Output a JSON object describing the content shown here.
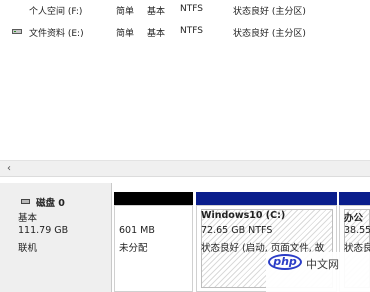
{
  "volumes": [
    {
      "name": "个人空间 (F:)",
      "layout": "简单",
      "type": "基本",
      "fs": "NTFS",
      "status": "状态良好 (主分区)"
    },
    {
      "name": "文件资料 (E:)",
      "layout": "简单",
      "type": "基本",
      "fs": "NTFS",
      "status": "状态良好 (主分区)"
    }
  ],
  "scroll": {
    "left_arrow": "‹"
  },
  "disk": {
    "name": "磁盘 0",
    "type": "基本",
    "size": "111.79 GB",
    "status": "联机"
  },
  "partitions": [
    {
      "bar_color": "#000000",
      "title": "",
      "size": "601 MB",
      "detail": "未分配"
    },
    {
      "bar_color": "#0a1e8c",
      "title": "Windows10  (C:)",
      "size": "72.65 GB NTFS",
      "detail": "状态良好 (启动, 页面文件, 故"
    },
    {
      "bar_color": "#0a1e8c",
      "title": "办公",
      "size": "38.55",
      "detail": "状态良"
    }
  ],
  "watermark": {
    "logo": "php",
    "text": "中文网"
  },
  "colors": {
    "unallocated": "#000000",
    "primary": "#0a1e8c"
  }
}
